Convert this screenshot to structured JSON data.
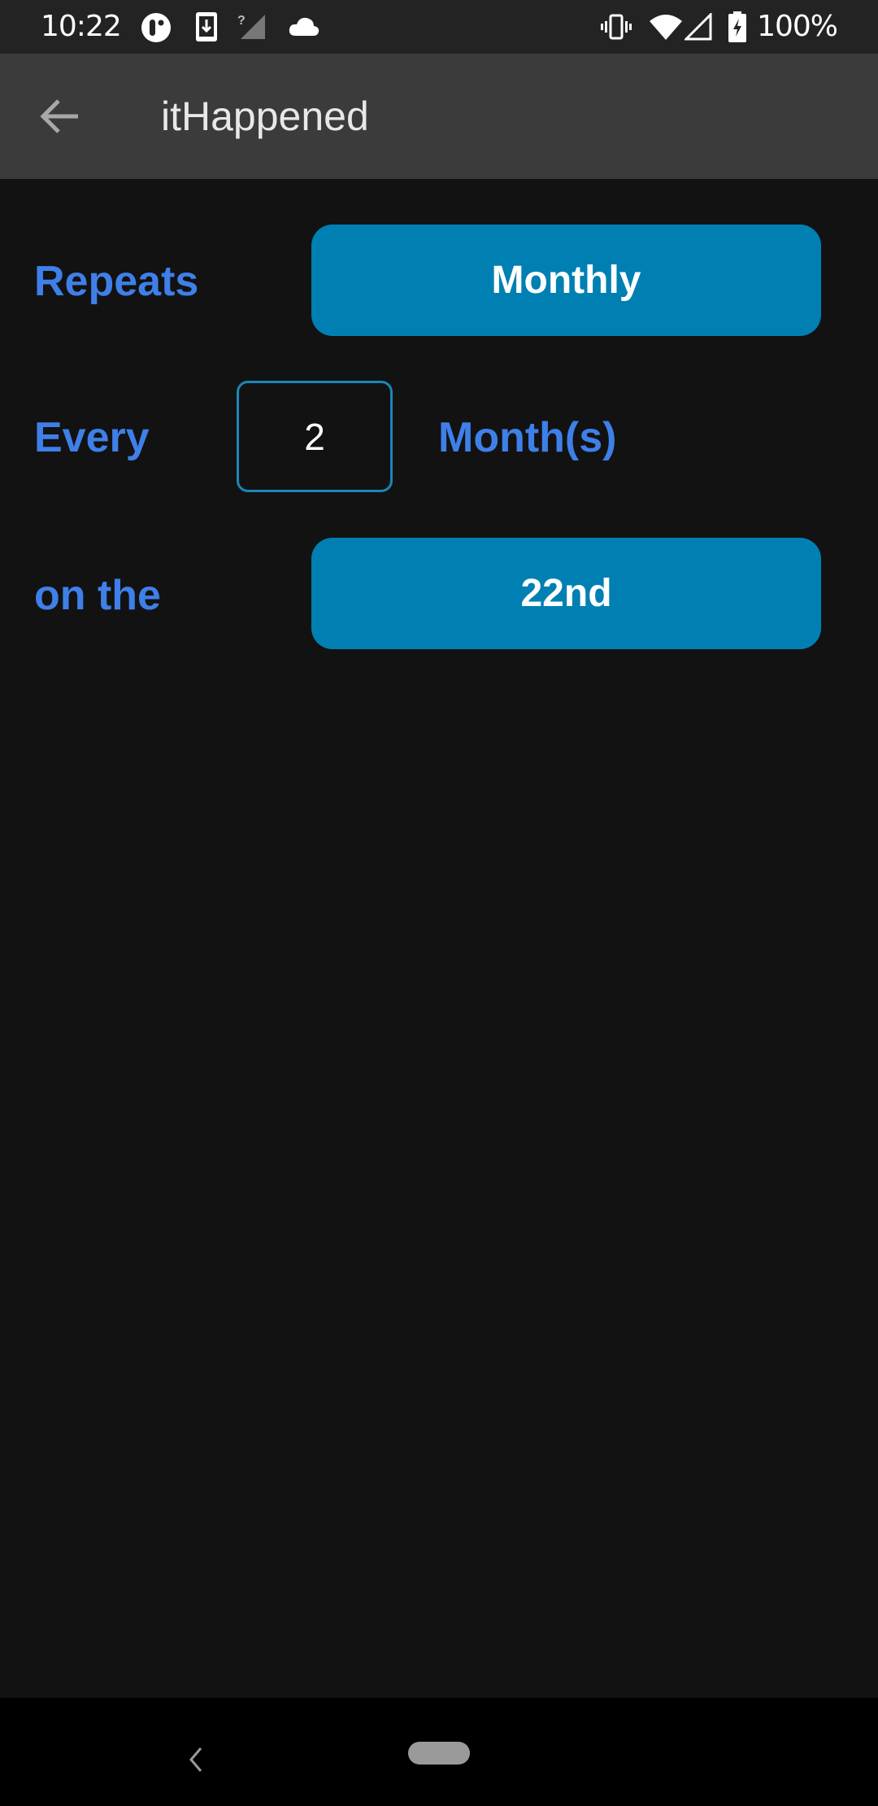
{
  "status_bar": {
    "time": "10:22",
    "left_icons": [
      "app-notification-icon",
      "download-icon",
      "no-sim-signal-icon",
      "cloud-icon"
    ],
    "right_icons": [
      "vibrate-icon",
      "wifi-icon",
      "cell-signal-icon",
      "battery-charging-icon"
    ],
    "battery_percent": "100%"
  },
  "app_bar": {
    "title": "itHappened",
    "back_icon": "arrow-left-icon"
  },
  "form": {
    "repeats": {
      "label": "Repeats",
      "value": "Monthly"
    },
    "every": {
      "label": "Every",
      "value": "2",
      "unit": "Month(s)"
    },
    "on_the": {
      "label": "on the",
      "value": "22nd"
    }
  },
  "colors": {
    "accent_label": "#3f7fe8",
    "button_fill": "#0080b2",
    "input_border": "#1a86b8",
    "background": "#121212",
    "app_bar": "#3b3b3b"
  },
  "nav_bar": {
    "back_icon": "chevron-left-icon",
    "home_icon": "home-pill-icon"
  }
}
